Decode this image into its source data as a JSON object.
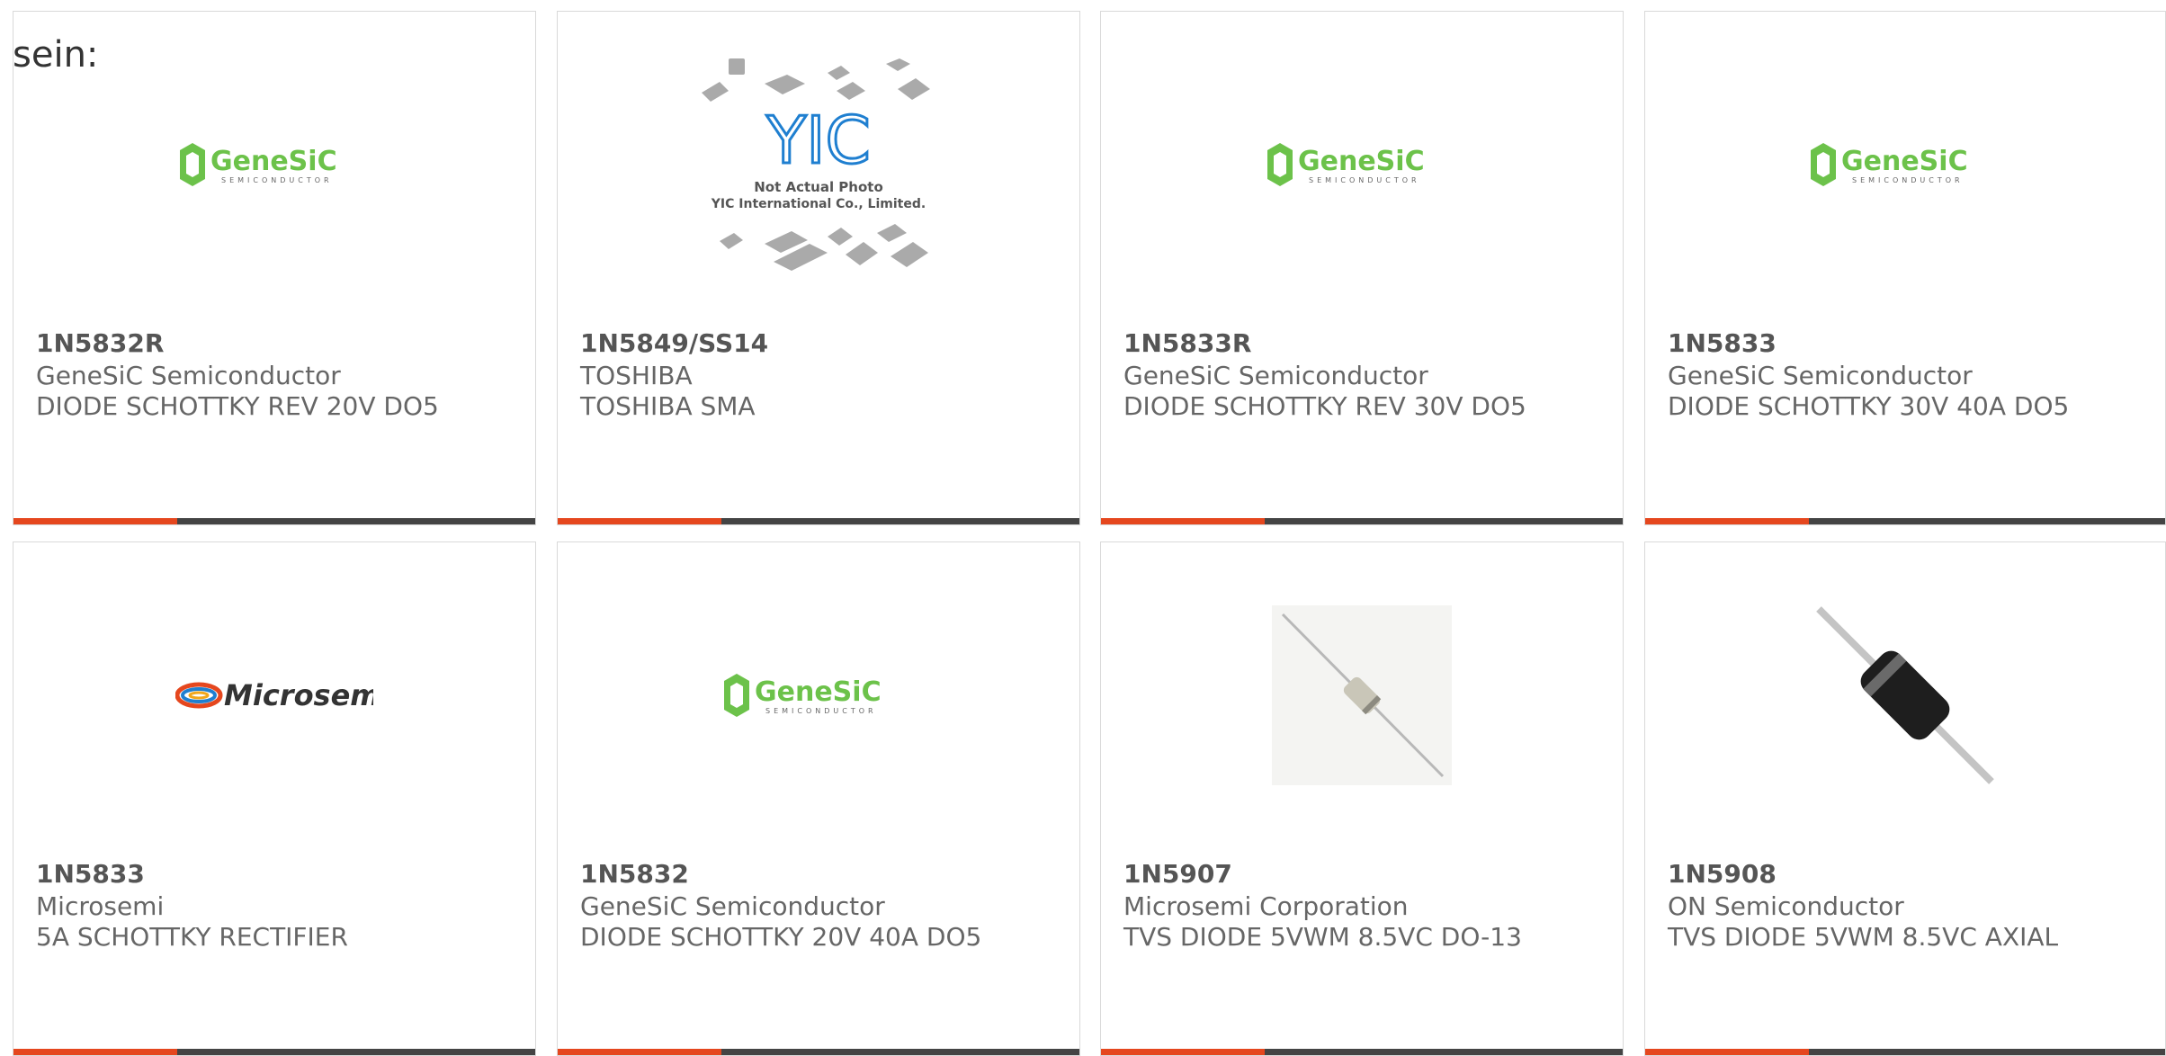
{
  "intro_text": "sein:",
  "colors": {
    "accent": "#e5471e",
    "bar": "#444444",
    "genesic_green": "#6cc24a",
    "text": "#666666"
  },
  "logos": {
    "genesic": {
      "name": "GeneSiC",
      "sub": "SEMICONDUCTOR"
    },
    "microsemi": {
      "name": "Microsemi"
    },
    "yic": {
      "mark": "YIC",
      "line1": "Not Actual Photo",
      "line2": "YIC International Co., Limited."
    }
  },
  "products": [
    {
      "part": "1N5832R",
      "manufacturer": "GeneSiC Semiconductor",
      "description": "DIODE SCHOTTKY REV 20V DO5",
      "image": "genesic-logo"
    },
    {
      "part": "1N5849/SS14",
      "manufacturer": "TOSHIBA",
      "description": "TOSHIBA SMA",
      "image": "not-actual-photo"
    },
    {
      "part": "1N5833R",
      "manufacturer": "GeneSiC Semiconductor",
      "description": "DIODE SCHOTTKY REV 30V DO5",
      "image": "genesic-logo"
    },
    {
      "part": "1N5833",
      "manufacturer": "GeneSiC Semiconductor",
      "description": "DIODE SCHOTTKY 30V 40A DO5",
      "image": "genesic-logo"
    },
    {
      "part": "1N5833",
      "manufacturer": "Microsemi",
      "description": "5A SCHOTTKY RECTIFIER",
      "image": "microsemi-logo"
    },
    {
      "part": "1N5832",
      "manufacturer": "GeneSiC Semiconductor",
      "description": "DIODE SCHOTTKY 20V 40A DO5",
      "image": "genesic-logo"
    },
    {
      "part": "1N5907",
      "manufacturer": "Microsemi Corporation",
      "description": "TVS DIODE 5VWM 8.5VC DO-13",
      "image": "axial-diode-small"
    },
    {
      "part": "1N5908",
      "manufacturer": "ON Semiconductor",
      "description": "TVS DIODE 5VWM 8.5VC AXIAL",
      "image": "axial-diode-black"
    }
  ]
}
